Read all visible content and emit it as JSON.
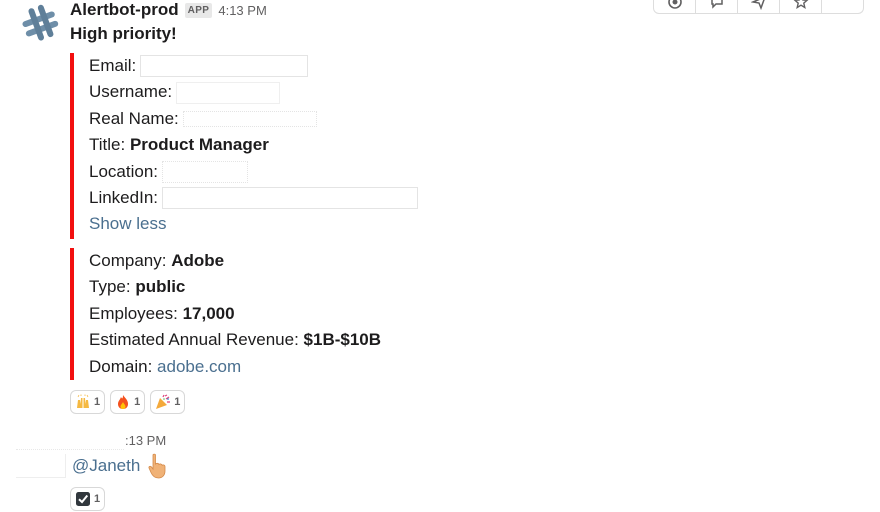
{
  "message": {
    "sender": "Alertbot-prod",
    "badge": "APP",
    "timestamp": "4:13 PM",
    "text": "High priority!",
    "attachment1": {
      "email_label": "Email:",
      "username_label": "Username:",
      "realname_label": "Real Name:",
      "title_label": "Title:",
      "title_value": "Product Manager",
      "location_label": "Location:",
      "linkedin_label": "LinkedIn:",
      "show_less": "Show less"
    },
    "attachment2": {
      "company_label": "Company:",
      "company_value": "Adobe",
      "type_label": "Type:",
      "type_value": "public",
      "employees_label": "Employees:",
      "employees_value": "17,000",
      "revenue_label": "Estimated Annual Revenue:",
      "revenue_value": "$1B-$10B",
      "domain_label": "Domain:",
      "domain_value": "adobe.com"
    },
    "reactions": [
      {
        "icon": "raised-hands-icon",
        "count": "1"
      },
      {
        "icon": "fire-icon",
        "count": "1"
      },
      {
        "icon": "party-popper-icon",
        "count": "1"
      }
    ]
  },
  "reply": {
    "timestamp": ":13 PM",
    "text": "@Janeth",
    "trailing_icon": "pointing-hand-icon",
    "reactions": [
      {
        "icon": "check-box-icon",
        "count": "1"
      }
    ]
  },
  "hover_actions": [
    "reaction-icon",
    "thread-icon",
    "share-icon",
    "star-icon",
    "more-icon"
  ],
  "colors": {
    "attachment_bar": "#f20f0f",
    "link": "#4a6f8f",
    "timestamp": "#616061"
  }
}
